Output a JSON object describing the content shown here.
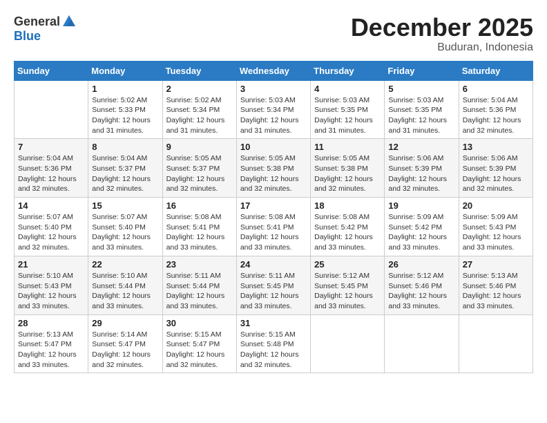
{
  "logo": {
    "general": "General",
    "blue": "Blue"
  },
  "title": "December 2025",
  "subtitle": "Buduran, Indonesia",
  "days_header": [
    "Sunday",
    "Monday",
    "Tuesday",
    "Wednesday",
    "Thursday",
    "Friday",
    "Saturday"
  ],
  "weeks": [
    [
      {
        "num": "",
        "info": ""
      },
      {
        "num": "1",
        "info": "Sunrise: 5:02 AM\nSunset: 5:33 PM\nDaylight: 12 hours\nand 31 minutes."
      },
      {
        "num": "2",
        "info": "Sunrise: 5:02 AM\nSunset: 5:34 PM\nDaylight: 12 hours\nand 31 minutes."
      },
      {
        "num": "3",
        "info": "Sunrise: 5:03 AM\nSunset: 5:34 PM\nDaylight: 12 hours\nand 31 minutes."
      },
      {
        "num": "4",
        "info": "Sunrise: 5:03 AM\nSunset: 5:35 PM\nDaylight: 12 hours\nand 31 minutes."
      },
      {
        "num": "5",
        "info": "Sunrise: 5:03 AM\nSunset: 5:35 PM\nDaylight: 12 hours\nand 31 minutes."
      },
      {
        "num": "6",
        "info": "Sunrise: 5:04 AM\nSunset: 5:36 PM\nDaylight: 12 hours\nand 32 minutes."
      }
    ],
    [
      {
        "num": "7",
        "info": "Sunrise: 5:04 AM\nSunset: 5:36 PM\nDaylight: 12 hours\nand 32 minutes."
      },
      {
        "num": "8",
        "info": "Sunrise: 5:04 AM\nSunset: 5:37 PM\nDaylight: 12 hours\nand 32 minutes."
      },
      {
        "num": "9",
        "info": "Sunrise: 5:05 AM\nSunset: 5:37 PM\nDaylight: 12 hours\nand 32 minutes."
      },
      {
        "num": "10",
        "info": "Sunrise: 5:05 AM\nSunset: 5:38 PM\nDaylight: 12 hours\nand 32 minutes."
      },
      {
        "num": "11",
        "info": "Sunrise: 5:05 AM\nSunset: 5:38 PM\nDaylight: 12 hours\nand 32 minutes."
      },
      {
        "num": "12",
        "info": "Sunrise: 5:06 AM\nSunset: 5:39 PM\nDaylight: 12 hours\nand 32 minutes."
      },
      {
        "num": "13",
        "info": "Sunrise: 5:06 AM\nSunset: 5:39 PM\nDaylight: 12 hours\nand 32 minutes."
      }
    ],
    [
      {
        "num": "14",
        "info": "Sunrise: 5:07 AM\nSunset: 5:40 PM\nDaylight: 12 hours\nand 32 minutes."
      },
      {
        "num": "15",
        "info": "Sunrise: 5:07 AM\nSunset: 5:40 PM\nDaylight: 12 hours\nand 33 minutes."
      },
      {
        "num": "16",
        "info": "Sunrise: 5:08 AM\nSunset: 5:41 PM\nDaylight: 12 hours\nand 33 minutes."
      },
      {
        "num": "17",
        "info": "Sunrise: 5:08 AM\nSunset: 5:41 PM\nDaylight: 12 hours\nand 33 minutes."
      },
      {
        "num": "18",
        "info": "Sunrise: 5:08 AM\nSunset: 5:42 PM\nDaylight: 12 hours\nand 33 minutes."
      },
      {
        "num": "19",
        "info": "Sunrise: 5:09 AM\nSunset: 5:42 PM\nDaylight: 12 hours\nand 33 minutes."
      },
      {
        "num": "20",
        "info": "Sunrise: 5:09 AM\nSunset: 5:43 PM\nDaylight: 12 hours\nand 33 minutes."
      }
    ],
    [
      {
        "num": "21",
        "info": "Sunrise: 5:10 AM\nSunset: 5:43 PM\nDaylight: 12 hours\nand 33 minutes."
      },
      {
        "num": "22",
        "info": "Sunrise: 5:10 AM\nSunset: 5:44 PM\nDaylight: 12 hours\nand 33 minutes."
      },
      {
        "num": "23",
        "info": "Sunrise: 5:11 AM\nSunset: 5:44 PM\nDaylight: 12 hours\nand 33 minutes."
      },
      {
        "num": "24",
        "info": "Sunrise: 5:11 AM\nSunset: 5:45 PM\nDaylight: 12 hours\nand 33 minutes."
      },
      {
        "num": "25",
        "info": "Sunrise: 5:12 AM\nSunset: 5:45 PM\nDaylight: 12 hours\nand 33 minutes."
      },
      {
        "num": "26",
        "info": "Sunrise: 5:12 AM\nSunset: 5:46 PM\nDaylight: 12 hours\nand 33 minutes."
      },
      {
        "num": "27",
        "info": "Sunrise: 5:13 AM\nSunset: 5:46 PM\nDaylight: 12 hours\nand 33 minutes."
      }
    ],
    [
      {
        "num": "28",
        "info": "Sunrise: 5:13 AM\nSunset: 5:47 PM\nDaylight: 12 hours\nand 33 minutes."
      },
      {
        "num": "29",
        "info": "Sunrise: 5:14 AM\nSunset: 5:47 PM\nDaylight: 12 hours\nand 32 minutes."
      },
      {
        "num": "30",
        "info": "Sunrise: 5:15 AM\nSunset: 5:47 PM\nDaylight: 12 hours\nand 32 minutes."
      },
      {
        "num": "31",
        "info": "Sunrise: 5:15 AM\nSunset: 5:48 PM\nDaylight: 12 hours\nand 32 minutes."
      },
      {
        "num": "",
        "info": ""
      },
      {
        "num": "",
        "info": ""
      },
      {
        "num": "",
        "info": ""
      }
    ]
  ]
}
